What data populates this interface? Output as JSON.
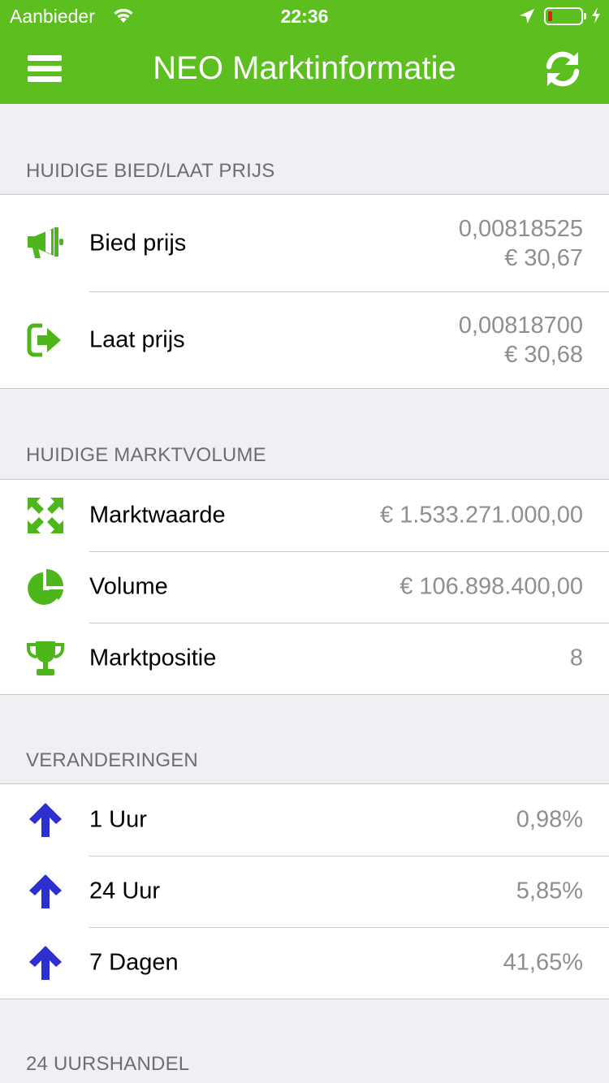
{
  "status_bar": {
    "carrier": "Aanbieder",
    "time": "22:36"
  },
  "nav": {
    "title": "NEO Marktinformatie"
  },
  "sections": {
    "prices": {
      "header": "HUIDIGE BIED/LAAT PRIJS",
      "bid": {
        "label": "Bied prijs",
        "btc": "0,00818525",
        "eur": "€ 30,67"
      },
      "ask": {
        "label": "Laat prijs",
        "btc": "0,00818700",
        "eur": "€ 30,68"
      }
    },
    "volume": {
      "header": "HUIDIGE MARKTVOLUME",
      "market_value": {
        "label": "Marktwaarde",
        "value": "€ 1.533.271.000,00"
      },
      "volume": {
        "label": "Volume",
        "value": "€ 106.898.400,00"
      },
      "rank": {
        "label": "Marktpositie",
        "value": "8"
      }
    },
    "changes": {
      "header": "VERANDERINGEN",
      "h1": {
        "label": "1 Uur",
        "value": "0,98%"
      },
      "h24": {
        "label": "24 Uur",
        "value": "5,85%"
      },
      "d7": {
        "label": "7 Dagen",
        "value": "41,65%"
      }
    },
    "trade": {
      "header": "24 UURSHANDEL"
    }
  },
  "colors": {
    "brand": "#5dbf1f",
    "icon_green": "#4cb61a",
    "arrow_blue": "#2d2fcf",
    "value_gray": "#8e8e93"
  },
  "icons": [
    "menu-icon",
    "refresh-icon",
    "megaphone-icon",
    "sign-out-icon",
    "expand-icon",
    "pie-chart-icon",
    "trophy-icon",
    "arrow-up-icon"
  ]
}
